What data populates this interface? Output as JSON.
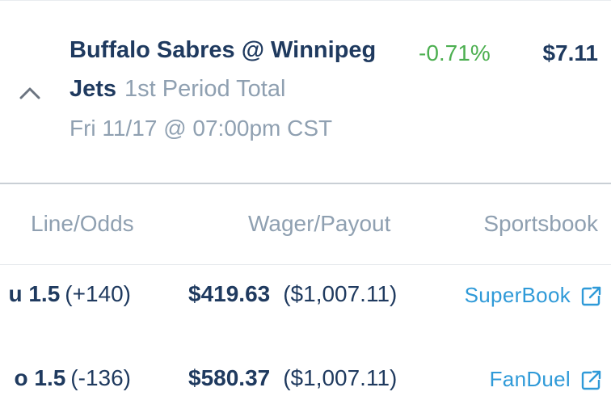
{
  "event": {
    "matchup": "Buffalo Sabres @ Winnipeg",
    "team": "Jets",
    "market": "1st Period Total",
    "datetime": "Fri 11/17 @ 07:00pm CST",
    "ev_percent": "-0.71%",
    "ev_amount": "$7.11"
  },
  "columns": {
    "line_odds": "Line/Odds",
    "wager_payout": "Wager/Payout",
    "sportsbook": "Sportsbook"
  },
  "bets": [
    {
      "line": "u 1.5",
      "odds": "(+140)",
      "wager": "$419.63",
      "payout": "($1,007.11)",
      "book": "SuperBook",
      "icon": "external-link-icon"
    },
    {
      "line": "o 1.5",
      "odds": "(-136)",
      "wager": "$580.37",
      "payout": "($1,007.11)",
      "book": "FanDuel",
      "icon": "external-link-icon"
    }
  ],
  "colors": {
    "primary_text": "#1f3a5f",
    "muted_text": "#8fa0b1",
    "positive_green": "#4caf50",
    "link_blue": "#2f9ad8"
  },
  "icons": {
    "collapse": "chevron-up-icon"
  }
}
